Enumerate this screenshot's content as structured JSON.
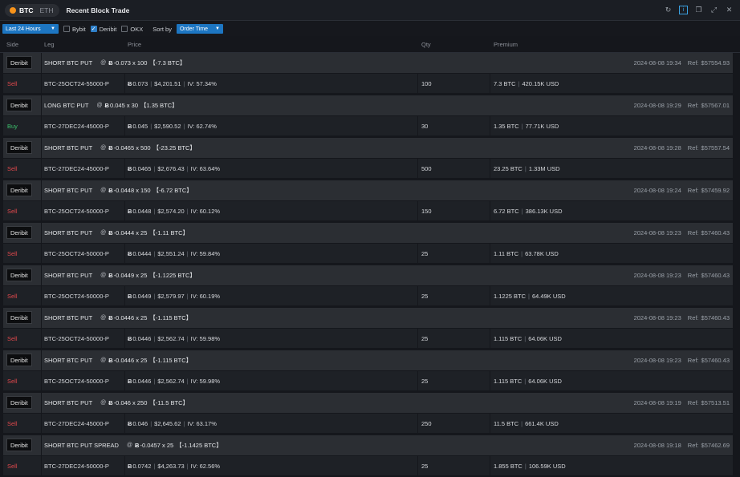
{
  "window": {
    "assets": [
      "BTC",
      "ETH"
    ],
    "active_asset": "BTC",
    "title": "Recent Block Trade"
  },
  "toolbar": {
    "period": "Last 24 Hours",
    "exchanges": [
      {
        "label": "Bybit",
        "checked": false
      },
      {
        "label": "Deribit",
        "checked": true
      },
      {
        "label": "OKX",
        "checked": false
      }
    ],
    "sort_label": "Sort by",
    "sort_value": "Order Time"
  },
  "columns": {
    "side": "Side",
    "leg": "Leg",
    "price": "Price",
    "qty": "Qty",
    "premium": "Premium"
  },
  "currency_symbol": "Ƀ",
  "ref_prefix": "Ref:",
  "trades": [
    {
      "exchange": "Deribit",
      "strategy": "SHORT BTC PUT",
      "summary": "-0.073 x 100",
      "total": "【-7.3 BTC】",
      "time": "2024-08-08 19:34",
      "ref": "$57554.93",
      "legs": [
        {
          "side": "Sell",
          "instrument": "BTC-25OCT24-55000-P",
          "price": "0.073",
          "usd": "$4,201.51",
          "iv": "IV: 57.34%",
          "qty": "100",
          "prem_btc": "7.3 BTC",
          "prem_usd": "420.15K USD"
        }
      ]
    },
    {
      "exchange": "Deribit",
      "strategy": "LONG BTC PUT",
      "summary": "0.045 x 30",
      "total": "【1.35 BTC】",
      "time": "2024-08-08 19:29",
      "ref": "$57567.01",
      "legs": [
        {
          "side": "Buy",
          "instrument": "BTC-27DEC24-45000-P",
          "price": "0.045",
          "usd": "$2,590.52",
          "iv": "IV: 62.74%",
          "qty": "30",
          "prem_btc": "1.35 BTC",
          "prem_usd": "77.71K USD"
        }
      ]
    },
    {
      "exchange": "Deribit",
      "strategy": "SHORT BTC PUT",
      "summary": "-0.0465 x 500",
      "total": "【-23.25 BTC】",
      "time": "2024-08-08 19:28",
      "ref": "$57557.54",
      "legs": [
        {
          "side": "Sell",
          "instrument": "BTC-27DEC24-45000-P",
          "price": "0.0465",
          "usd": "$2,676.43",
          "iv": "IV: 63.64%",
          "qty": "500",
          "prem_btc": "23.25 BTC",
          "prem_usd": "1.33M USD"
        }
      ]
    },
    {
      "exchange": "Deribit",
      "strategy": "SHORT BTC PUT",
      "summary": "-0.0448 x 150",
      "total": "【-6.72 BTC】",
      "time": "2024-08-08 19:24",
      "ref": "$57459.92",
      "legs": [
        {
          "side": "Sell",
          "instrument": "BTC-25OCT24-50000-P",
          "price": "0.0448",
          "usd": "$2,574.20",
          "iv": "IV: 60.12%",
          "qty": "150",
          "prem_btc": "6.72 BTC",
          "prem_usd": "386.13K USD"
        }
      ]
    },
    {
      "exchange": "Deribit",
      "strategy": "SHORT BTC PUT",
      "summary": "-0.0444 x 25",
      "total": "【-1.11 BTC】",
      "time": "2024-08-08 19:23",
      "ref": "$57460.43",
      "legs": [
        {
          "side": "Sell",
          "instrument": "BTC-25OCT24-50000-P",
          "price": "0.0444",
          "usd": "$2,551.24",
          "iv": "IV: 59.84%",
          "qty": "25",
          "prem_btc": "1.11 BTC",
          "prem_usd": "63.78K USD"
        }
      ]
    },
    {
      "exchange": "Deribit",
      "strategy": "SHORT BTC PUT",
      "summary": "-0.0449 x 25",
      "total": "【-1.1225 BTC】",
      "time": "2024-08-08 19:23",
      "ref": "$57460.43",
      "legs": [
        {
          "side": "Sell",
          "instrument": "BTC-25OCT24-50000-P",
          "price": "0.0449",
          "usd": "$2,579.97",
          "iv": "IV: 60.19%",
          "qty": "25",
          "prem_btc": "1.1225 BTC",
          "prem_usd": "64.49K USD"
        }
      ]
    },
    {
      "exchange": "Deribit",
      "strategy": "SHORT BTC PUT",
      "summary": "-0.0446 x 25",
      "total": "【-1.115 BTC】",
      "time": "2024-08-08 19:23",
      "ref": "$57460.43",
      "legs": [
        {
          "side": "Sell",
          "instrument": "BTC-25OCT24-50000-P",
          "price": "0.0446",
          "usd": "$2,562.74",
          "iv": "IV: 59.98%",
          "qty": "25",
          "prem_btc": "1.115 BTC",
          "prem_usd": "64.06K USD"
        }
      ]
    },
    {
      "exchange": "Deribit",
      "strategy": "SHORT BTC PUT",
      "summary": "-0.0446 x 25",
      "total": "【-1.115 BTC】",
      "time": "2024-08-08 19:23",
      "ref": "$57460.43",
      "legs": [
        {
          "side": "Sell",
          "instrument": "BTC-25OCT24-50000-P",
          "price": "0.0446",
          "usd": "$2,562.74",
          "iv": "IV: 59.98%",
          "qty": "25",
          "prem_btc": "1.115 BTC",
          "prem_usd": "64.06K USD"
        }
      ]
    },
    {
      "exchange": "Deribit",
      "strategy": "SHORT BTC PUT",
      "summary": "-0.046 x 250",
      "total": "【-11.5 BTC】",
      "time": "2024-08-08 19:19",
      "ref": "$57513.51",
      "legs": [
        {
          "side": "Sell",
          "instrument": "BTC-27DEC24-45000-P",
          "price": "0.046",
          "usd": "$2,645.62",
          "iv": "IV: 63.17%",
          "qty": "250",
          "prem_btc": "11.5 BTC",
          "prem_usd": "661.4K USD"
        }
      ]
    },
    {
      "exchange": "Deribit",
      "strategy": "SHORT BTC PUT SPREAD",
      "summary": "-0.0457 x 25",
      "total": "【-1.1425 BTC】",
      "time": "2024-08-08 19:18",
      "ref": "$57462.69",
      "legs": [
        {
          "side": "Sell",
          "instrument": "BTC-27DEC24-50000-P",
          "price": "0.0742",
          "usd": "$4,263.73",
          "iv": "IV: 62.56%",
          "qty": "25",
          "prem_btc": "1.855 BTC",
          "prem_usd": "106.59K USD"
        }
      ]
    }
  ]
}
